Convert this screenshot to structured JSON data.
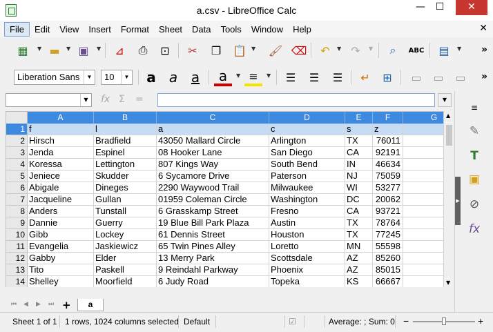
{
  "window": {
    "title": "a.csv - LibreOffice Calc",
    "min": "—",
    "max": "☐",
    "close": "✕"
  },
  "menu": [
    {
      "label": "File",
      "name": "menu-file"
    },
    {
      "label": "Edit",
      "name": "menu-edit"
    },
    {
      "label": "View",
      "name": "menu-view"
    },
    {
      "label": "Insert",
      "name": "menu-insert"
    },
    {
      "label": "Format",
      "name": "menu-format"
    },
    {
      "label": "Sheet",
      "name": "menu-sheet"
    },
    {
      "label": "Data",
      "name": "menu-data"
    },
    {
      "label": "Tools",
      "name": "menu-tools"
    },
    {
      "label": "Window",
      "name": "menu-window"
    },
    {
      "label": "Help",
      "name": "menu-help"
    }
  ],
  "format_toolbar": {
    "font_name": "Liberation Sans",
    "font_size": "10"
  },
  "columns": [
    "A",
    "B",
    "C",
    "D",
    "E",
    "F",
    "G"
  ],
  "rows": [
    {
      "n": "1",
      "cells": [
        "f",
        "l",
        "a",
        "c",
        "s",
        "z"
      ]
    },
    {
      "n": "2",
      "cells": [
        "Hirsch",
        "Bradfield",
        "43050 Mallard Circle",
        "Arlington",
        "TX",
        "76011"
      ]
    },
    {
      "n": "3",
      "cells": [
        "Jenda",
        "Espinel",
        "08 Hooker Lane",
        "San Diego",
        "CA",
        "92191"
      ]
    },
    {
      "n": "4",
      "cells": [
        "Koressa",
        "Lettington",
        "807 Kings Way",
        "South Bend",
        "IN",
        "46634"
      ]
    },
    {
      "n": "5",
      "cells": [
        "Jeniece",
        "Skudder",
        "6 Sycamore Drive",
        "Paterson",
        "NJ",
        "75059"
      ]
    },
    {
      "n": "6",
      "cells": [
        "Abigale",
        "Dineges",
        "2290 Waywood Trail",
        "Milwaukee",
        "WI",
        "53277"
      ]
    },
    {
      "n": "7",
      "cells": [
        "Jacqueline",
        "Gullan",
        "01959 Coleman Circle",
        "Washington",
        "DC",
        "20062"
      ]
    },
    {
      "n": "8",
      "cells": [
        "Anders",
        "Tunstall",
        "6 Grasskamp Street",
        "Fresno",
        "CA",
        "93721"
      ]
    },
    {
      "n": "9",
      "cells": [
        "Dannie",
        "Guerry",
        "19 Blue Bill Park Plaza",
        "Austin",
        "TX",
        "78764"
      ]
    },
    {
      "n": "10",
      "cells": [
        "Gibb",
        "Lockey",
        "61 Dennis Street",
        "Houston",
        "TX",
        "77245"
      ]
    },
    {
      "n": "11",
      "cells": [
        "Evangelia",
        "Jaskiewicz",
        "65 Twin Pines Alley",
        "Loretto",
        "MN",
        "55598"
      ]
    },
    {
      "n": "12",
      "cells": [
        "Gabby",
        "Elder",
        "13 Merry Park",
        "Scottsdale",
        "AZ",
        "85260"
      ]
    },
    {
      "n": "13",
      "cells": [
        "Tito",
        "Paskell",
        "9 Reindahl Parkway",
        "Phoenix",
        "AZ",
        "85015"
      ]
    },
    {
      "n": "14",
      "cells": [
        "Shelley",
        "Moorfield",
        "6 Judy Road",
        "Topeka",
        "KS",
        "66667"
      ]
    }
  ],
  "sheet_tab": "a",
  "status": {
    "sheet": "Sheet 1 of 1",
    "selection": "1 rows, 1024 columns selected",
    "style": "Default",
    "summary": "Average: ; Sum: 0",
    "zoom_minus": "−",
    "zoom_plus": "+"
  },
  "colors": {
    "accent": "#3d8ae0",
    "selection_fill": "#c6dcf5",
    "close_red": "#c7372f"
  }
}
